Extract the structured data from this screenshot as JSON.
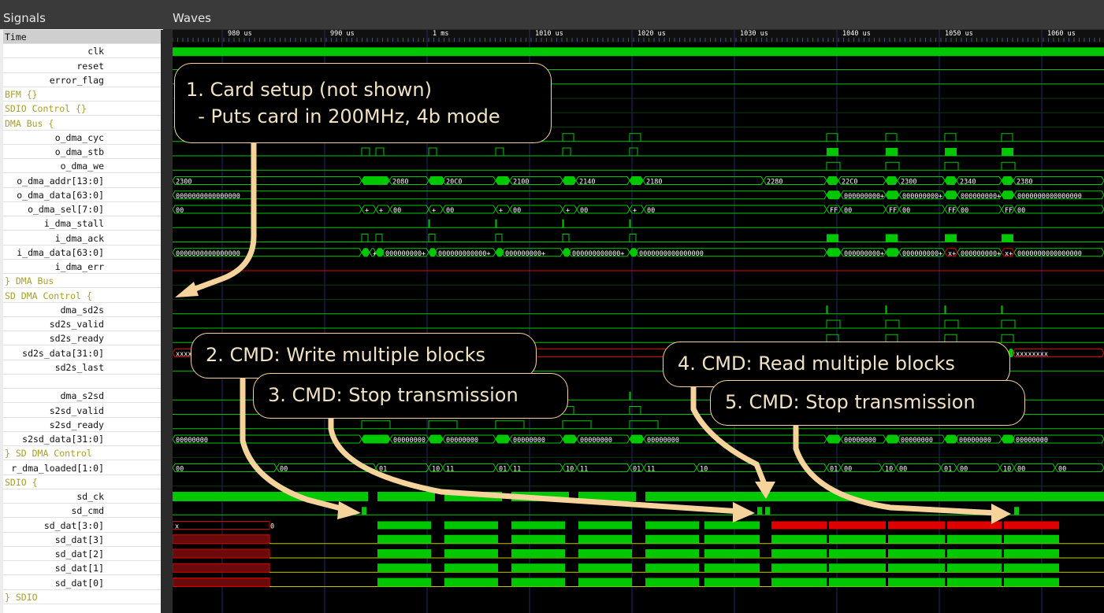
{
  "panels": {
    "signals_title": "Signals",
    "waves_title": "Waves"
  },
  "time_axis": {
    "label": "Time",
    "ticks": [
      "980 us",
      "990 us",
      "1 ms",
      "1010 us",
      "1020 us",
      "1030 us",
      "1040 us",
      "1050 us",
      "1060 us"
    ]
  },
  "signals": [
    {
      "label": "Time",
      "kind": "time"
    },
    {
      "label": "clk",
      "kind": "leaf"
    },
    {
      "label": "reset",
      "kind": "leaf"
    },
    {
      "label": "error_flag",
      "kind": "leaf"
    },
    {
      "label": "BFM {}",
      "kind": "group"
    },
    {
      "label": "SDIO Control {}",
      "kind": "group"
    },
    {
      "label": "DMA Bus {",
      "kind": "group"
    },
    {
      "label": "o_dma_cyc",
      "kind": "leaf"
    },
    {
      "label": "o_dma_stb",
      "kind": "leaf"
    },
    {
      "label": "o_dma_we",
      "kind": "leaf"
    },
    {
      "label": "o_dma_addr[13:0]",
      "kind": "leaf"
    },
    {
      "label": "o_dma_data[63:0]",
      "kind": "leaf"
    },
    {
      "label": "o_dma_sel[7:0]",
      "kind": "leaf"
    },
    {
      "label": "i_dma_stall",
      "kind": "leaf"
    },
    {
      "label": "i_dma_ack",
      "kind": "leaf"
    },
    {
      "label": "i_dma_data[63:0]",
      "kind": "leaf"
    },
    {
      "label": "i_dma_err",
      "kind": "leaf"
    },
    {
      "label": "} DMA Bus",
      "kind": "group"
    },
    {
      "label": "SD DMA Control {",
      "kind": "group"
    },
    {
      "label": "dma_sd2s",
      "kind": "leaf"
    },
    {
      "label": "sd2s_valid",
      "kind": "leaf"
    },
    {
      "label": "sd2s_ready",
      "kind": "leaf"
    },
    {
      "label": "sd2s_data[31:0]",
      "kind": "leaf"
    },
    {
      "label": "sd2s_last",
      "kind": "leaf"
    },
    {
      "label": "",
      "kind": "leaf"
    },
    {
      "label": "dma_s2sd",
      "kind": "leaf"
    },
    {
      "label": "s2sd_valid",
      "kind": "leaf"
    },
    {
      "label": "s2sd_ready",
      "kind": "leaf"
    },
    {
      "label": "s2sd_data[31:0]",
      "kind": "leaf"
    },
    {
      "label": "} SD DMA Control",
      "kind": "group"
    },
    {
      "label": "r_dma_loaded[1:0]",
      "kind": "leaf"
    },
    {
      "label": "SDIO {",
      "kind": "group"
    },
    {
      "label": "sd_ck",
      "kind": "leaf"
    },
    {
      "label": "sd_cmd",
      "kind": "leaf"
    },
    {
      "label": "sd_dat[3:0]",
      "kind": "leaf"
    },
    {
      "label": "sd_dat[3]",
      "kind": "leaf"
    },
    {
      "label": "sd_dat[2]",
      "kind": "leaf"
    },
    {
      "label": "sd_dat[1]",
      "kind": "leaf"
    },
    {
      "label": "sd_dat[0]",
      "kind": "leaf"
    },
    {
      "label": "} SDIO",
      "kind": "group"
    }
  ],
  "wave_values": {
    "addr": [
      "2300",
      "2080",
      "20C0",
      "2100",
      "2140",
      "2180",
      "2280",
      "22C0",
      "2300",
      "2340",
      "2380"
    ],
    "o_data": [
      "0000000000000000",
      "000000000+",
      "000000000+",
      "000000000+",
      "0000000000000000"
    ],
    "sel": [
      "00",
      "+",
      "+",
      "00",
      "+",
      "00",
      "+",
      "00",
      "+",
      "00",
      "+",
      "00",
      "FF",
      "00",
      "FF",
      "00",
      "FF",
      "00",
      "FF",
      "00"
    ],
    "i_data": [
      "0000000000000000",
      "+",
      "000000000+",
      "000000000000+",
      "000000000+",
      "000000000000+",
      "0000000000000000",
      "000000000+",
      "000000000+",
      "x+",
      "000000000+",
      "x+",
      "0000000000000000"
    ],
    "sd2s_data": [
      "xxxx",
      "xxxxxxxx"
    ],
    "s2sd_data": [
      "00000000",
      "00000000",
      "00000000",
      "00000000",
      "00000000",
      "00000000",
      "00000000",
      "00000000",
      "00000000",
      "00000000"
    ],
    "dma_loaded": [
      "00",
      "00",
      "01",
      "10",
      "11",
      "01",
      "11",
      "10",
      "11",
      "01",
      "11",
      "10",
      "01",
      "00",
      "10",
      "00",
      "01",
      "00",
      "10",
      "00",
      "00"
    ],
    "sd_dat": [
      "x",
      "0"
    ]
  },
  "colors": {
    "wave": "#00c800",
    "wave_fill": "#00c800",
    "error": "#e00000",
    "grid": "#1f2a6a",
    "text": "#ffffff",
    "group_text": "#a7a02a",
    "arrow": "#f6d39a"
  },
  "callouts": [
    "1. Card setup (not shown)\n  - Puts card in 200MHz, 4b mode",
    "2. CMD: Write multiple blocks",
    "3. CMD: Stop transmission",
    "4. CMD: Read multiple blocks",
    "5. CMD: Stop transmission"
  ]
}
